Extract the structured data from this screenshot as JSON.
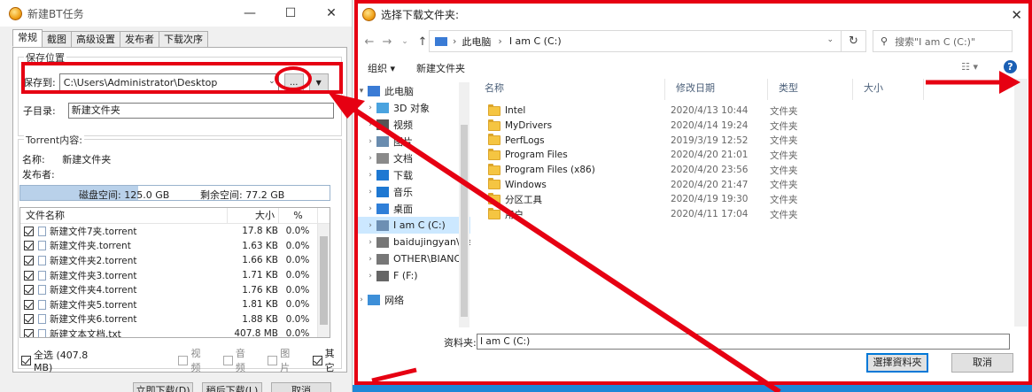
{
  "bt_window": {
    "title": "新建BT任务",
    "tabs": [
      "常规",
      "截图",
      "高级设置",
      "发布者",
      "下载次序"
    ],
    "save_group_label": "保存位置",
    "save_to_label": "保存到:",
    "save_path": "C:\\Users\\Administrator\\Desktop",
    "browse_label": "...",
    "subdir_label": "子目录:",
    "subdir_value": "新建文件夹",
    "torrent_group_label": "Torrent内容:",
    "name_label": "名称:",
    "name_value": "新建文件夹",
    "publisher_label": "发布者:",
    "disk_space_text": "磁盘空间: 125.0 GB",
    "free_space_text": "剩余空间: 77.2 GB",
    "disk_used_fraction": 0.38,
    "columns": [
      "文件名称",
      "大小",
      "%"
    ],
    "files": [
      {
        "name": "新建文件7夹.torrent",
        "size": "17.8 KB",
        "pct": "0.0%"
      },
      {
        "name": "新建文件夹.torrent",
        "size": "1.63 KB",
        "pct": "0.0%"
      },
      {
        "name": "新建文件夹2.torrent",
        "size": "1.66 KB",
        "pct": "0.0%"
      },
      {
        "name": "新建文件夹3.torrent",
        "size": "1.71 KB",
        "pct": "0.0%"
      },
      {
        "name": "新建文件夹4.torrent",
        "size": "1.76 KB",
        "pct": "0.0%"
      },
      {
        "name": "新建文件夹5.torrent",
        "size": "1.81 KB",
        "pct": "0.0%"
      },
      {
        "name": "新建文件夹6.torrent",
        "size": "1.88 KB",
        "pct": "0.0%"
      },
      {
        "name": "新建文本文档.txt",
        "size": "407.8 MB",
        "pct": "0.0%"
      }
    ],
    "select_all_label": "全选 (407.8 MB)",
    "filters": [
      "视频",
      "音频",
      "图片",
      "其它"
    ],
    "bottom_buttons": [
      "立即下载(D)",
      "稍后下载(L)",
      "取消"
    ]
  },
  "folder_dialog": {
    "title": "选择下载文件夹:",
    "breadcrumb": [
      "此电脑",
      "I am C (C:)"
    ],
    "search_placeholder": "搜索\"I am C (C:)\"",
    "organize_label": "组织 ▾",
    "new_folder_label": "新建文件夹",
    "tree": [
      {
        "label": "此电脑",
        "icon": "computer-icon",
        "expanded": true
      },
      {
        "label": "3D 对象",
        "icon": "3d-objects-icon"
      },
      {
        "label": "视频",
        "icon": "video-icon"
      },
      {
        "label": "图片",
        "icon": "pictures-icon"
      },
      {
        "label": "文档",
        "icon": "documents-icon"
      },
      {
        "label": "下载",
        "icon": "download-icon"
      },
      {
        "label": "音乐",
        "icon": "music-icon"
      },
      {
        "label": "桌面",
        "icon": "desktop-icon"
      },
      {
        "label": "I am C (C:)",
        "icon": "drive-c-icon",
        "selected": true
      },
      {
        "label": "baidujingyan\\wa",
        "icon": "network-drive-icon"
      },
      {
        "label": "OTHER\\BIANCH",
        "icon": "network-drive-icon"
      },
      {
        "label": "F (F:)",
        "icon": "drive-icon"
      },
      {
        "label": "网络",
        "icon": "network-icon"
      }
    ],
    "columns": [
      "名称",
      "修改日期",
      "类型",
      "大小"
    ],
    "folders": [
      {
        "name": "Intel",
        "date": "2020/4/13 10:44",
        "type": "文件夹"
      },
      {
        "name": "MyDrivers",
        "date": "2020/4/14 19:24",
        "type": "文件夹"
      },
      {
        "name": "PerfLogs",
        "date": "2019/3/19 12:52",
        "type": "文件夹"
      },
      {
        "name": "Program Files",
        "date": "2020/4/20 21:01",
        "type": "文件夹"
      },
      {
        "name": "Program Files (x86)",
        "date": "2020/4/20 23:56",
        "type": "文件夹"
      },
      {
        "name": "Windows",
        "date": "2020/4/20 21:47",
        "type": "文件夹"
      },
      {
        "name": "分区工具",
        "date": "2020/4/19 19:30",
        "type": "文件夹"
      },
      {
        "name": "用户",
        "date": "2020/4/11 17:04",
        "type": "文件夹"
      }
    ],
    "folder_label": "资料夹:",
    "folder_value": "I am C (C:)",
    "select_button": "選擇資料夾",
    "cancel_button": "取消"
  },
  "colors": {
    "annotation": "#e60012",
    "selection": "#cce8ff",
    "accent": "#0078d7"
  }
}
